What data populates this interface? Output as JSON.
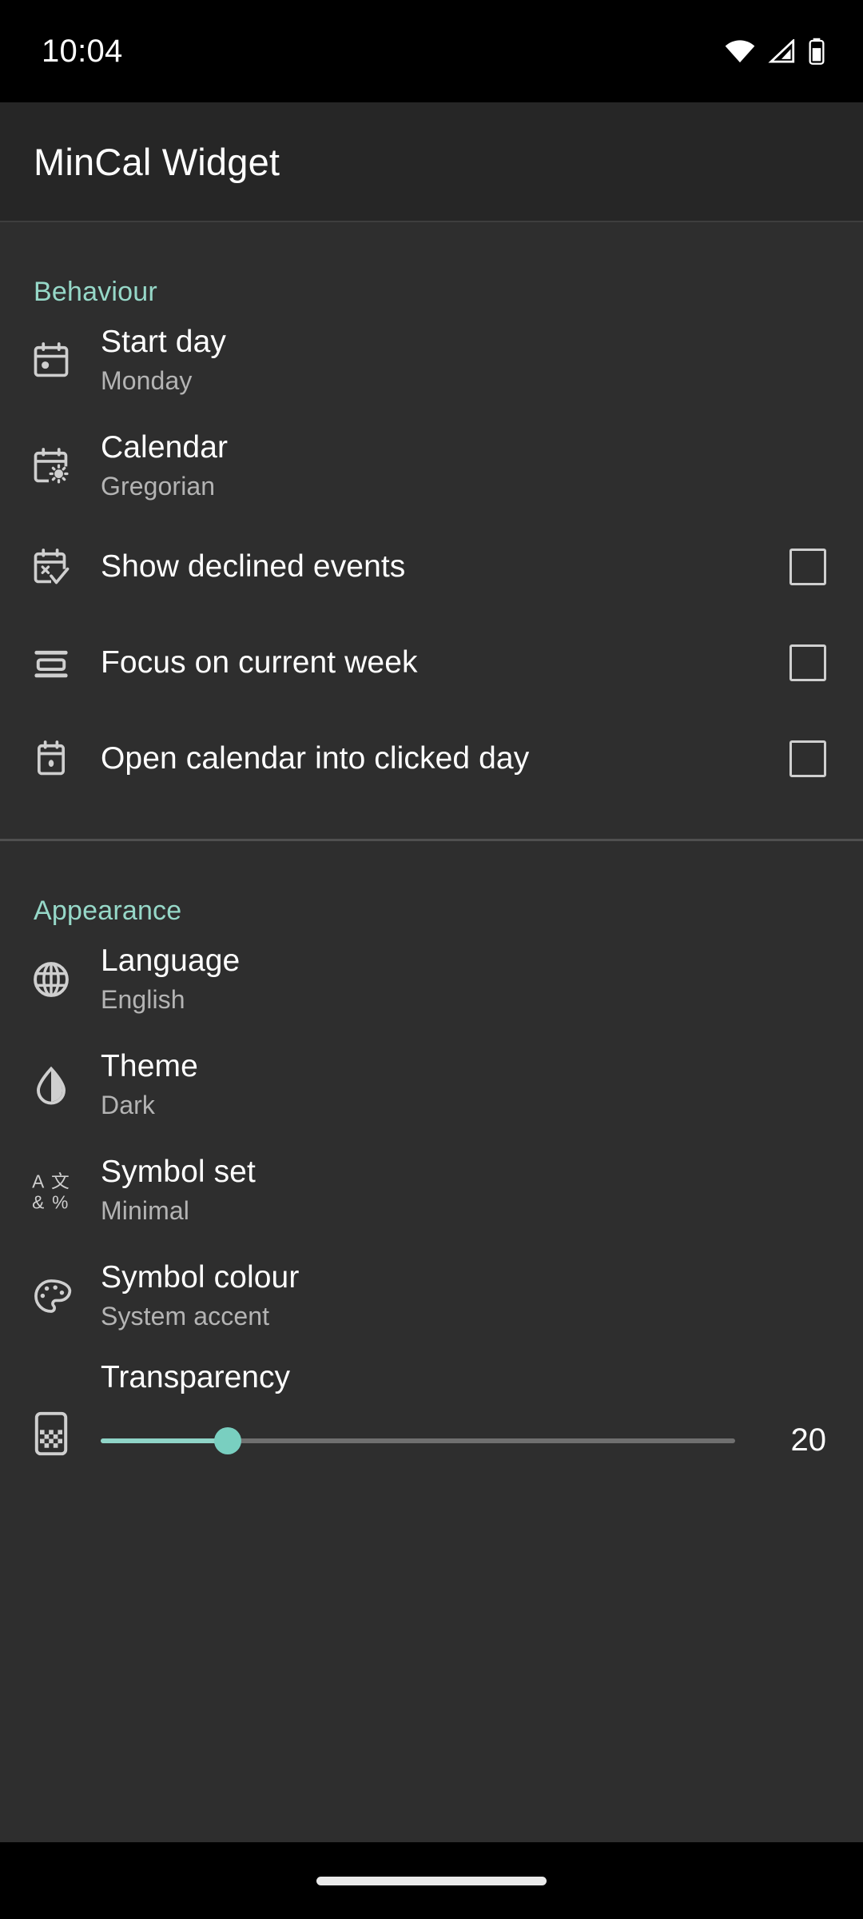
{
  "status_bar": {
    "time": "10:04",
    "icons": [
      "wifi-icon",
      "cellular-signal-icon",
      "battery-icon"
    ]
  },
  "app_bar": {
    "title": "MinCal Widget"
  },
  "theme_colors": {
    "accent": "#96d8c8",
    "slider_fill": "#8fd4c7",
    "slider_thumb": "#79cfc0",
    "background": "#2e2e2e",
    "app_bar_background": "#262626",
    "status_bar_background": "#000000",
    "primary_text": "#ffffff",
    "secondary_text": "#b4b4b4"
  },
  "sections": [
    {
      "id": "behaviour",
      "title": "Behaviour",
      "rows": [
        {
          "id": "start-day",
          "icon": "calendar-day-icon",
          "title": "Start day",
          "subtitle": "Monday",
          "control": "none"
        },
        {
          "id": "calendar",
          "icon": "calendar-sun-icon",
          "title": "Calendar",
          "subtitle": "Gregorian",
          "control": "none"
        },
        {
          "id": "show-declined-events",
          "icon": "calendar-declined-icon",
          "title": "Show declined events",
          "subtitle": "",
          "control": "checkbox",
          "checked": false
        },
        {
          "id": "focus-on-current-week",
          "icon": "rows-focus-icon",
          "title": "Focus on current week",
          "subtitle": "",
          "control": "checkbox",
          "checked": false
        },
        {
          "id": "open-calendar-into-clicked-day",
          "icon": "calendar-open-day-icon",
          "title": "Open calendar into clicked day",
          "subtitle": "",
          "control": "checkbox",
          "checked": false
        }
      ]
    },
    {
      "id": "appearance",
      "title": "Appearance",
      "rows": [
        {
          "id": "language",
          "icon": "globe-icon",
          "title": "Language",
          "subtitle": "English",
          "control": "none"
        },
        {
          "id": "theme",
          "icon": "contrast-droplet-icon",
          "title": "Theme",
          "subtitle": "Dark",
          "control": "none"
        },
        {
          "id": "symbol-set",
          "icon": "glyph-set-icon",
          "title": "Symbol set",
          "subtitle": "Minimal",
          "control": "none"
        },
        {
          "id": "symbol-colour",
          "icon": "palette-icon",
          "title": "Symbol colour",
          "subtitle": "System accent",
          "control": "none"
        }
      ],
      "slider_row": {
        "id": "transparency",
        "icon": "checkerboard-icon",
        "title": "Transparency",
        "value": 20,
        "value_label": "20",
        "min": 0,
        "max": 100,
        "percent": 20
      }
    }
  ],
  "nav_bar": {
    "handle": "gesture-handle"
  }
}
